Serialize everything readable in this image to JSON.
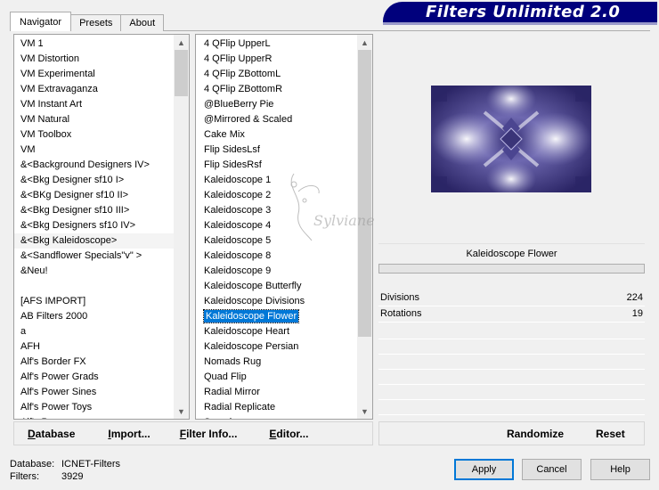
{
  "app": {
    "title": "Filters Unlimited 2.0"
  },
  "tabs": [
    {
      "label": "Navigator",
      "active": true
    },
    {
      "label": "Presets",
      "active": false
    },
    {
      "label": "About",
      "active": false
    }
  ],
  "categories": [
    "VM 1",
    "VM Distortion",
    "VM Experimental",
    "VM Extravaganza",
    "VM Instant Art",
    "VM Natural",
    "VM Toolbox",
    "VM",
    "&<Background Designers IV>",
    "&<Bkg Designer sf10 I>",
    "&<BKg Designer sf10 II>",
    "&<Bkg Designer sf10 III>",
    "&<Bkg Designers sf10 IV>",
    "&<Bkg Kaleidoscope>",
    "&<Sandflower Specials\"v\" >",
    "&Neu!",
    "",
    "[AFS IMPORT]",
    "AB Filters 2000",
    "a",
    "AFH",
    "Alf's Border FX",
    "Alf's Power Grads",
    "Alf's Power Sines",
    "Alf's Power Toys",
    "Alf's Power..."
  ],
  "categories_hover_index": 13,
  "filters": [
    "4 QFlip UpperL",
    "4 QFlip UpperR",
    "4 QFlip ZBottomL",
    "4 QFlip ZBottomR",
    "@BlueBerry Pie",
    "@Mirrored & Scaled",
    "Cake Mix",
    "Flip SidesLsf",
    "Flip SidesRsf",
    "Kaleidoscope 1",
    "Kaleidoscope 2",
    "Kaleidoscope 3",
    "Kaleidoscope 4",
    "Kaleidoscope 5",
    "Kaleidoscope 8",
    "Kaleidoscope 9",
    "Kaleidoscope Butterfly",
    "Kaleidoscope Divisions",
    "Kaleidoscope Flower",
    "Kaleidoscope Heart",
    "Kaleidoscope Persian",
    "Nomads Rug",
    "Quad Flip",
    "Radial Mirror",
    "Radial Replicate",
    "Seamless..."
  ],
  "filters_selected_index": 18,
  "preview": {
    "filter_name": "Kaleidoscope Flower",
    "colors": {
      "dark": "#2b2566",
      "mid": "#6e68b0",
      "light": "#d6d4f0"
    }
  },
  "params": [
    {
      "name": "Divisions",
      "value": "224"
    },
    {
      "name": "Rotations",
      "value": "19"
    }
  ],
  "left_buttons": [
    {
      "label": "Database",
      "underline": "D",
      "rest": "atabase"
    },
    {
      "label": "Import...",
      "underline": "I",
      "rest": "mport..."
    },
    {
      "label": "Filter Info...",
      "underline": "F",
      "rest": "ilter Info..."
    },
    {
      "label": "Editor...",
      "underline": "E",
      "rest": "ditor..."
    }
  ],
  "right_buttons": [
    {
      "label": "Randomize"
    },
    {
      "label": "Reset"
    }
  ],
  "status": {
    "database_label": "Database:",
    "database_value": "ICNET-Filters",
    "filters_label": "Filters:",
    "filters_value": "3929"
  },
  "dialog_buttons": {
    "apply": "Apply",
    "cancel": "Cancel",
    "help": "Help"
  },
  "watermark": "Sylviane"
}
